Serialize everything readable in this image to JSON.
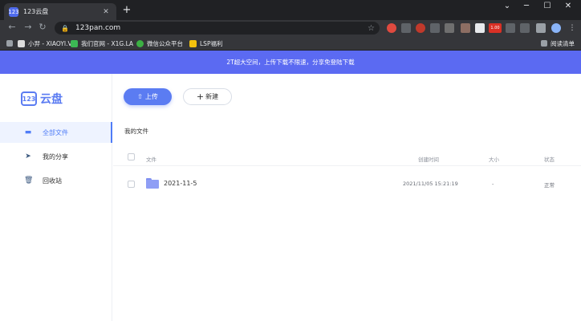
{
  "browser": {
    "tab_title": "123云盘",
    "tab_favicon_text": "123",
    "tab_close": "✕",
    "new_tab": "+",
    "window_controls": {
      "minimize": "─",
      "maximize": "☐",
      "close": "✕",
      "chevron": "⌄"
    },
    "url": "123pan.com",
    "nav": {
      "back": "←",
      "forward": "→",
      "reload": "↻"
    },
    "reading_list_label": "阅读清单",
    "bookmarks": [
      {
        "label": "小羿 - XIAOYI.VC",
        "color": "#dcdcdc"
      },
      {
        "label": "我们官网 - X1G.LA",
        "color": "#3cba54"
      },
      {
        "label": "微信公众平台",
        "color": "#3cb043"
      },
      {
        "label": "LSP福利",
        "color": "#f4c20d"
      }
    ],
    "extension_badge": "1.00"
  },
  "banner": {
    "text": "2T超大空间，上传下载不限速，分享免登陆下载"
  },
  "logo": {
    "mark": "123",
    "text": "云盘"
  },
  "sidebar": {
    "items": [
      {
        "label": "全部文件",
        "icon": "folder-icon",
        "glyph": "▬",
        "active": true
      },
      {
        "label": "我的分享",
        "icon": "share-icon",
        "glyph": "➤",
        "active": false
      },
      {
        "label": "回收站",
        "icon": "trash-icon",
        "glyph": "🗑",
        "active": false
      }
    ]
  },
  "toolbar": {
    "upload_label": "上传",
    "upload_icon": "⇧",
    "new_label": "新建",
    "new_icon": "+"
  },
  "breadcrumb": "我的文件",
  "table": {
    "headers": {
      "name": "文件",
      "created": "创建时间",
      "size": "大小",
      "status": "状态"
    },
    "rows": [
      {
        "name": "2021-11-5",
        "created": "2021/11/05 15:21:19",
        "size": "-",
        "status": "正常"
      }
    ]
  },
  "colors": {
    "accent": "#5b7cf2",
    "banner": "#5b6af2",
    "browser_dark": "#202124",
    "toolbar": "#35363a"
  }
}
